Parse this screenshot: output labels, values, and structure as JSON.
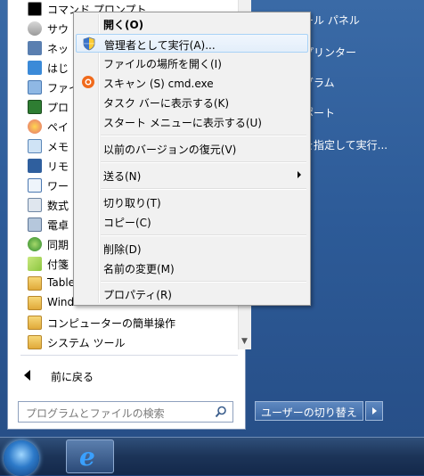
{
  "program_list": [
    {
      "label": "コマンド プロンプト",
      "icon": "cmd-icon"
    },
    {
      "label": "サウ",
      "icon": "sound-recorder-icon"
    },
    {
      "label": "ネッ",
      "icon": "network-projector-icon"
    },
    {
      "label": "はじ",
      "icon": "getting-started-icon"
    },
    {
      "label": "ファイ",
      "icon": "file-explorer-icon"
    },
    {
      "label": "プロ",
      "icon": "projector-icon"
    },
    {
      "label": "ペイ",
      "icon": "paint-icon"
    },
    {
      "label": "メモ",
      "icon": "notepad-icon"
    },
    {
      "label": "リモ",
      "icon": "remote-desktop-icon"
    },
    {
      "label": "ワー",
      "icon": "wordpad-icon"
    },
    {
      "label": "数式",
      "icon": "math-input-icon"
    },
    {
      "label": "電卓",
      "icon": "calculator-icon"
    },
    {
      "label": "同期",
      "icon": "sync-center-icon"
    },
    {
      "label": "付箋",
      "icon": "sticky-notes-icon"
    },
    {
      "label": "Table",
      "icon": "folder-icon"
    },
    {
      "label": "Wind",
      "icon": "folder-icon"
    },
    {
      "label": "コンピューターの簡単操作",
      "icon": "folder-icon"
    },
    {
      "label": "システム ツール",
      "icon": "folder-icon"
    }
  ],
  "back_label": "前に戻る",
  "search_placeholder": "プログラムとファイルの検索",
  "right_pane": [
    "ール パネル",
    "プリンター",
    "グラム",
    "ポート",
    "を指定して実行..."
  ],
  "switch_user_label": "ユーザーの切り替え",
  "context_menu": {
    "items": [
      {
        "label": "開く(O)",
        "bold": true
      },
      {
        "label": "管理者として実行(A)...",
        "icon": "uac-shield-icon"
      },
      {
        "label": "ファイルの場所を開く(I)"
      },
      {
        "label": "スキャン (S) cmd.exe",
        "icon": "antivirus-icon"
      },
      {
        "label": "タスク バーに表示する(K)"
      },
      {
        "label": "スタート メニューに表示する(U)"
      },
      {
        "label": "以前のバージョンの復元(V)"
      },
      {
        "label": "送る(N)",
        "submenu": true
      },
      {
        "label": "切り取り(T)"
      },
      {
        "label": "コピー(C)"
      },
      {
        "label": "削除(D)"
      },
      {
        "label": "名前の変更(M)"
      },
      {
        "label": "プロパティ(R)"
      }
    ],
    "hover_index": 1
  },
  "colors": {
    "menu_hover_border": "#a8d2f7",
    "start_menu_blue": "#2d5b98"
  }
}
